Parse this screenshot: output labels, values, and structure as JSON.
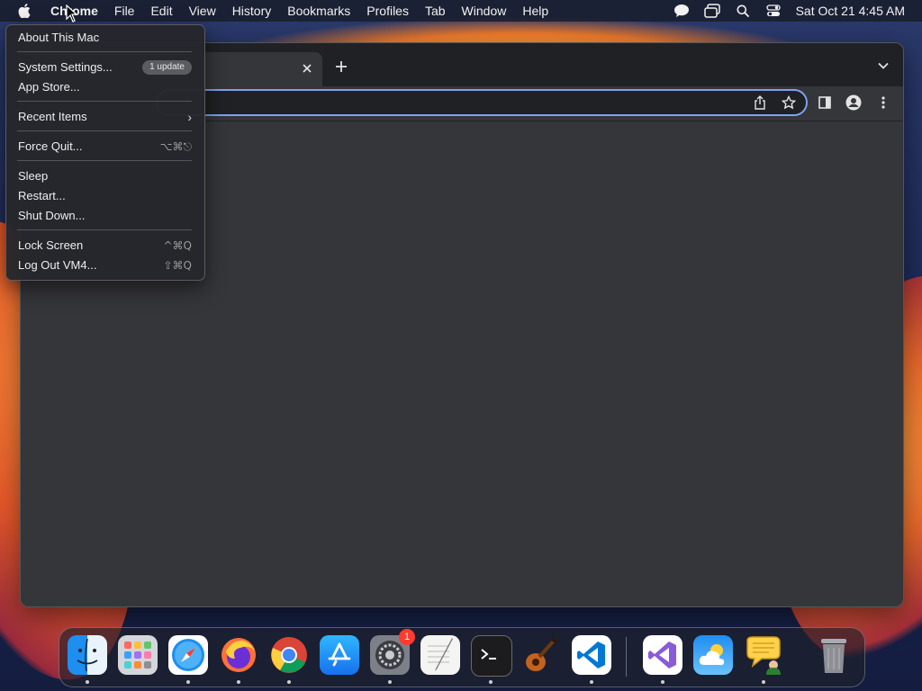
{
  "menubar": {
    "app_name": "Chrome",
    "items": [
      "File",
      "Edit",
      "View",
      "History",
      "Bookmarks",
      "Profiles",
      "Tab",
      "Window",
      "Help"
    ],
    "status_icons": [
      "chat-bubble-icon",
      "screens-icon",
      "search-icon",
      "control-center-icon"
    ],
    "clock": "Sat Oct 21  4:45 AM"
  },
  "apple_menu": {
    "about": "About This Mac",
    "system_settings": "System Settings...",
    "update_badge": "1 update",
    "app_store": "App Store...",
    "recent_items": "Recent Items",
    "force_quit": "Force Quit...",
    "force_quit_shortcut": "⌥⌘⎋",
    "sleep": "Sleep",
    "restart": "Restart...",
    "shut_down": "Shut Down...",
    "lock_screen": "Lock Screen",
    "lock_screen_shortcut": "^⌘Q",
    "log_out": "Log Out VM4...",
    "log_out_shortcut": "⇧⌘Q"
  },
  "chrome": {
    "tab_close_icon": "close-icon",
    "new_tab_icon": "plus-icon",
    "toolbar_icons": [
      "share-icon",
      "bookmark-star-icon",
      "side-panel-icon",
      "profile-icon",
      "more-menu-icon"
    ]
  },
  "dock": {
    "apps": [
      "Finder",
      "Launchpad",
      "Safari",
      "Firefox",
      "Google Chrome",
      "App Store",
      "System Settings",
      "TextEdit",
      "Terminal",
      "GarageBand",
      "Visual Studio Code",
      "Visual Studio",
      "Weather",
      "Speech",
      "Trash"
    ],
    "system_settings_badge": "1"
  }
}
